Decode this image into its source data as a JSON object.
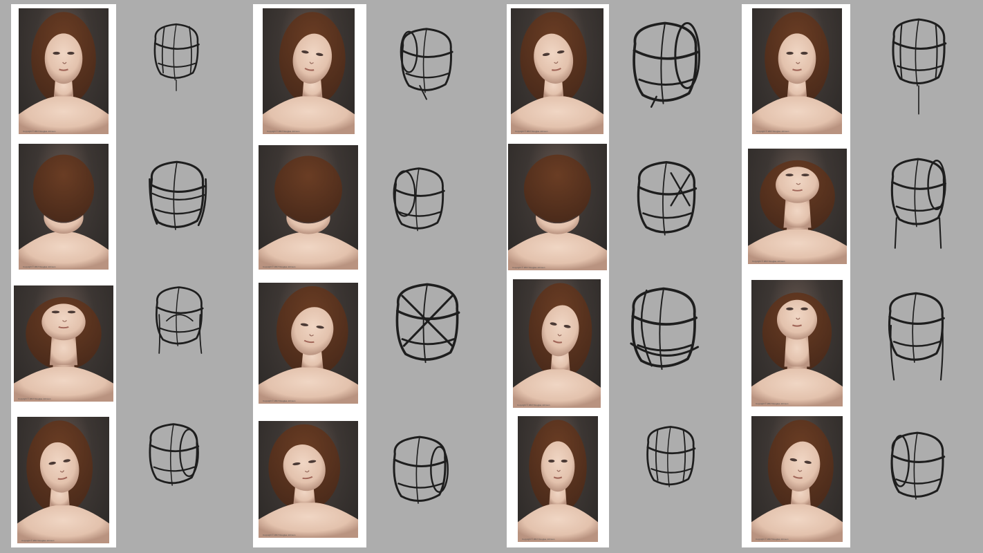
{
  "photo_caption": "Copyright © 2017 Douglas Johnson",
  "colors": {
    "background": "#adadad",
    "strip": "#ffffff",
    "sketch_stroke": "#1e1e1e",
    "skin": "#e3c2ad",
    "hair": "#4a2a1a"
  },
  "columns": [
    {
      "rows": [
        {
          "pose": "front-tilt-down",
          "sketch": "front-down"
        },
        {
          "pose": "top-down",
          "sketch": "top-down"
        },
        {
          "pose": "looking-up-front",
          "sketch": "looking-up"
        },
        {
          "pose": "three-quarter-up-left",
          "sketch": "three-quarter-left"
        }
      ]
    },
    {
      "rows": [
        {
          "pose": "three-quarter-down-right",
          "sketch": "three-quarter-down"
        },
        {
          "pose": "top-down-profile",
          "sketch": "side-down"
        },
        {
          "pose": "profile-up-right",
          "sketch": "tilt-up-right"
        },
        {
          "pose": "three-quarter-left-shadow",
          "sketch": "three-quarter-left-low"
        }
      ]
    },
    {
      "rows": [
        {
          "pose": "three-quarter-down-left",
          "sketch": "large-down"
        },
        {
          "pose": "top-down-crown",
          "sketch": "crown"
        },
        {
          "pose": "three-quarter-up-right",
          "sketch": "up-right"
        },
        {
          "pose": "front-level",
          "sketch": "front-level"
        }
      ]
    },
    {
      "rows": [
        {
          "pose": "front-down-eyes-closed",
          "sketch": "front-down-2"
        },
        {
          "pose": "looking-up-left",
          "sketch": "up-left"
        },
        {
          "pose": "front-up",
          "sketch": "front-up"
        },
        {
          "pose": "three-quarter-right-shadow",
          "sketch": "three-quarter-right"
        }
      ]
    }
  ]
}
